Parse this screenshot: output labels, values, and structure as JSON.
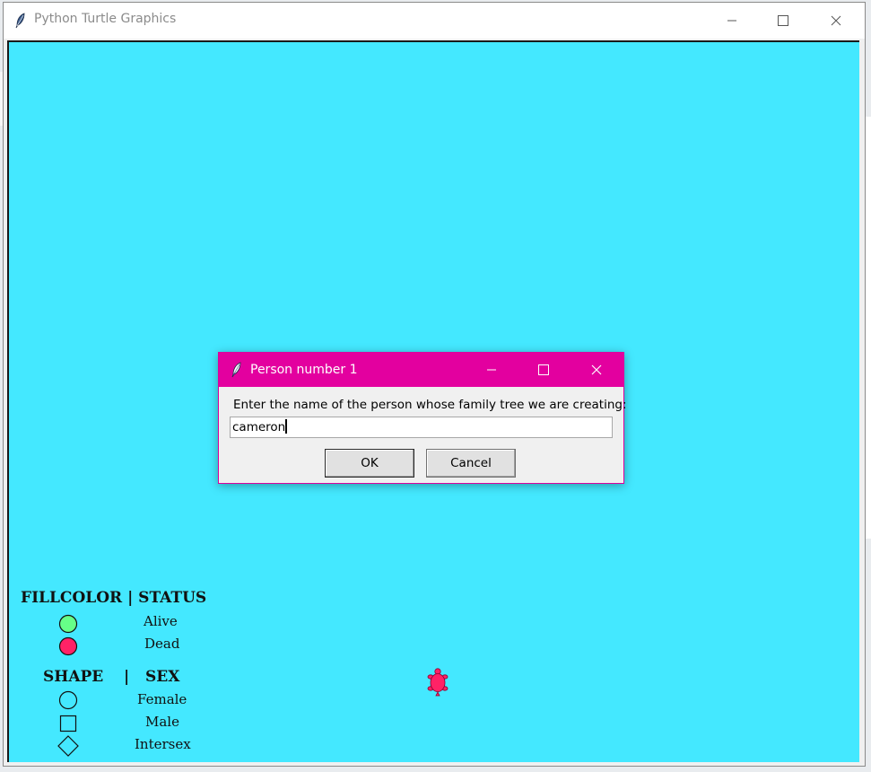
{
  "window": {
    "title": "Python Turtle Graphics",
    "canvas_color": "#44e8ff"
  },
  "legend": {
    "fill_header": "FILLCOLOR | STATUS",
    "fill_items": [
      {
        "label": "Alive",
        "color": "#66ff88"
      },
      {
        "label": "Dead",
        "color": "#ff2266"
      }
    ],
    "shape_header_left": "SHAPE",
    "shape_header_sep": "|",
    "shape_header_right": "SEX",
    "shape_items": [
      {
        "label": "Female",
        "shape": "circle"
      },
      {
        "label": "Male",
        "shape": "square"
      },
      {
        "label": "Intersex",
        "shape": "diamond"
      }
    ]
  },
  "turtle": {
    "color": "#ff2266"
  },
  "dialog": {
    "title": "Person number 1",
    "prompt": "Enter the name of the person whose family tree we are creating:",
    "input_value": "cameron",
    "ok_label": "OK",
    "cancel_label": "Cancel",
    "accent": "#e3009f"
  }
}
